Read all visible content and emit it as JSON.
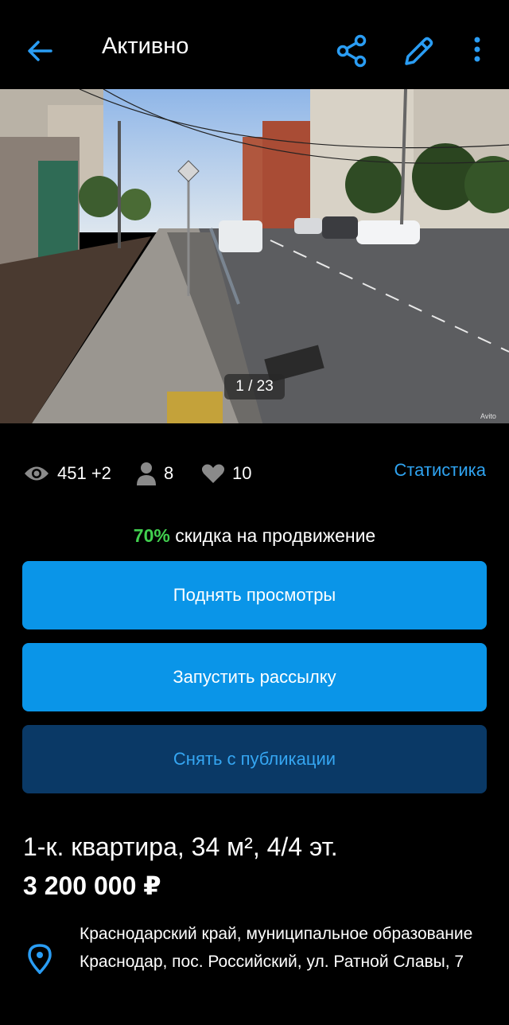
{
  "header": {
    "title": "Активно",
    "back_icon": "arrow-left-icon",
    "share_icon": "share-icon",
    "edit_icon": "pencil-icon",
    "more_icon": "more-vertical-icon",
    "accent_color": "#2a9df4"
  },
  "gallery": {
    "counter": "1 / 23",
    "watermark": "Avito"
  },
  "stats": {
    "views": "451 +2",
    "contacts": "8",
    "favorites": "10",
    "link_label": "Статистика"
  },
  "promo": {
    "percent": "70%",
    "text": " скидка на продвижение",
    "accent_color": "#41d04f"
  },
  "actions": {
    "boost_label": "Поднять просмотры",
    "mailing_label": "Запустить рассылку",
    "unpublish_label": "Снять с публикации"
  },
  "listing": {
    "title": "1-к. квартира, 34 м², 4/4 эт.",
    "price": "3 200 000 ₽",
    "address": "Краснодарский край, муниципальное образование Краснодар, пос. Российский, ул. Ратной Славы, 7"
  }
}
